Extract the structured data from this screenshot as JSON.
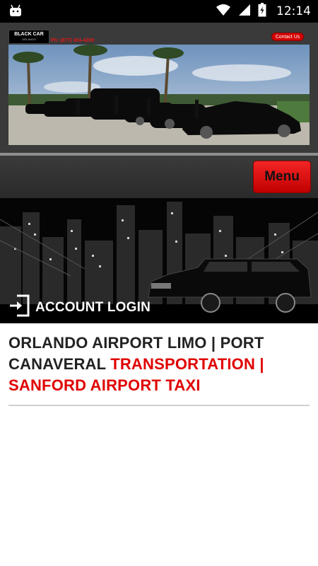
{
  "status_bar": {
    "time": "12:14"
  },
  "header": {
    "logo_main": "BLACK CAR",
    "logo_sub": "ORLANDO",
    "phone": "Ph: (877) 304-4209",
    "contact_label": "Contact Us"
  },
  "menu": {
    "label": "Menu"
  },
  "banner": {
    "login_label": "ACCOUNT LOGIN"
  },
  "page": {
    "title_part1": "ORLANDO AIRPORT LIMO | PORT CANAVERAL ",
    "title_part2": "TRANSPORTATION | SANFORD AIRPORT TAXI"
  },
  "colors": {
    "accent_red": "#e00000",
    "header_bg": "#3a3a3a"
  },
  "icons": [
    "android-icon",
    "wifi-icon",
    "signal-icon",
    "battery-icon",
    "login-icon"
  ]
}
